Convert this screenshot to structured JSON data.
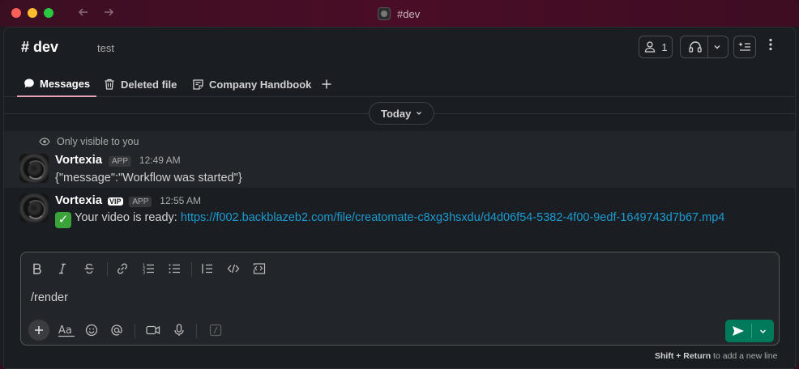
{
  "window": {
    "title": "#dev"
  },
  "channel": {
    "name": "# dev",
    "topic": "test"
  },
  "header": {
    "member_count": "1"
  },
  "tabs": [
    {
      "label": "Messages"
    },
    {
      "label": "Deleted file"
    },
    {
      "label": "Company Handbook"
    }
  ],
  "date_divider": "Today",
  "messages": [
    {
      "note": "Only visible to you",
      "author": "Vortexia",
      "badge": "APP",
      "time": "12:49 AM",
      "text": "{\"message\":\"Workflow was started\"}"
    },
    {
      "author": "Vortexia",
      "vip": "VIP",
      "badge": "APP",
      "time": "12:55 AM",
      "prefix": "Your video is ready: ",
      "link": "https://f002.backblazeb2.com/file/creatomate-c8xg3hsxdu/d4d06f54-5382-4f00-9edf-1649743d7b67.mp4"
    }
  ],
  "composer": {
    "value": "/render"
  },
  "hint": {
    "keys": "Shift + Return",
    "text": " to add a new line"
  },
  "colors": {
    "accent": "#007a5a",
    "link": "#1d9bd1",
    "titlebar": "#4a0d27"
  }
}
